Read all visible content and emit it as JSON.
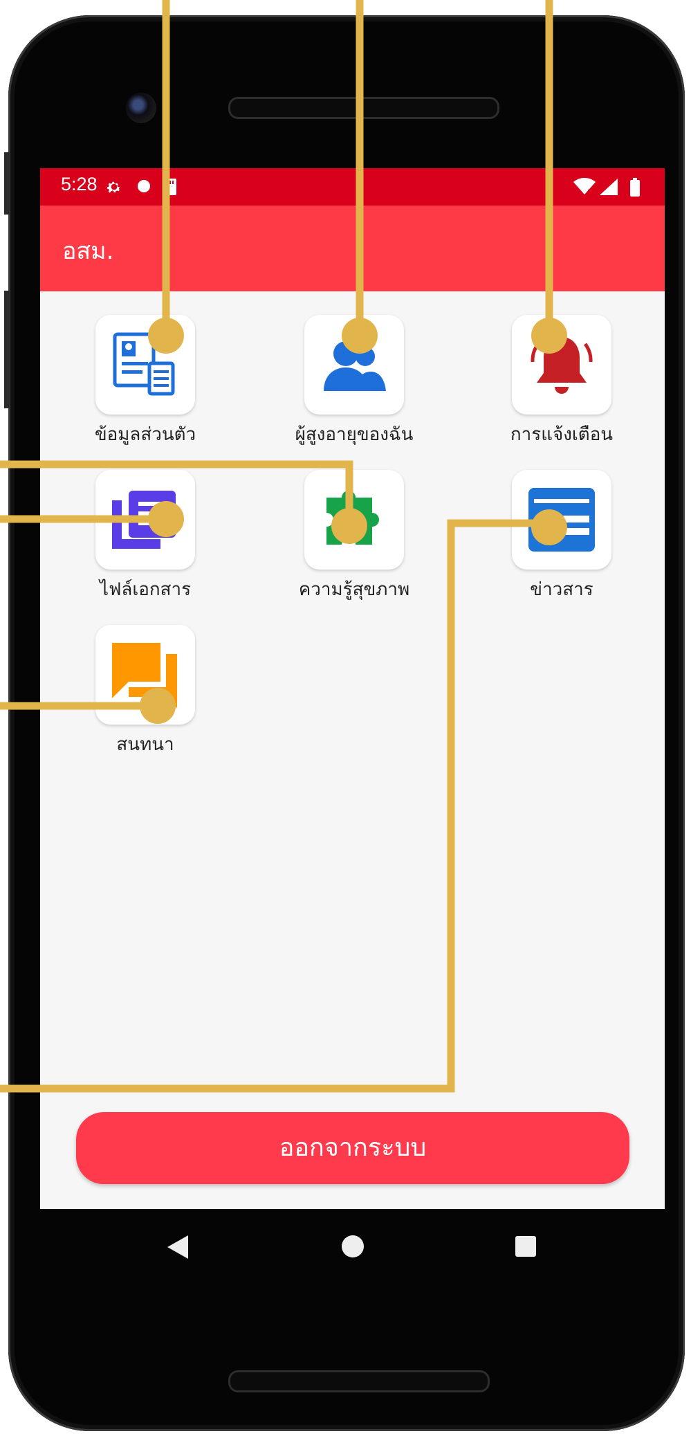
{
  "status_bar": {
    "time": "5:28",
    "icons": [
      "settings-icon",
      "notification-dot-icon",
      "sd-card-icon",
      "wifi-icon",
      "signal-icon",
      "battery-icon"
    ]
  },
  "app_bar": {
    "title": "อสม."
  },
  "menu": {
    "items": [
      {
        "label": "ข้อมูลส่วนตัว",
        "icon": "profile-document-icon",
        "color": "#1e6fd9"
      },
      {
        "label": "ผู้สูงอายุของฉัน",
        "icon": "users-icon",
        "color": "#1e6fd9"
      },
      {
        "label": "การแจ้งเตือน",
        "icon": "bell-icon",
        "color": "#c42026"
      },
      {
        "label": "ไฟล์เอกสาร",
        "icon": "files-icon",
        "color": "#5b3de8"
      },
      {
        "label": "ความรู้สุขภาพ",
        "icon": "puzzle-icon",
        "color": "#16a34a"
      },
      {
        "label": "ข่าวสาร",
        "icon": "news-icon",
        "color": "#1e74d6"
      },
      {
        "label": "สนทนา",
        "icon": "chat-icon",
        "color": "#ff9800"
      }
    ]
  },
  "logout": {
    "label": "ออกจากระบบ"
  },
  "nav": {
    "icons": [
      "back-icon",
      "home-icon",
      "recents-icon"
    ]
  },
  "colors": {
    "status_bar": "#d9001c",
    "app_bar": "#ff3a47",
    "logout_button": "#ff3a4c",
    "callout_lines": "#e2b44c"
  }
}
